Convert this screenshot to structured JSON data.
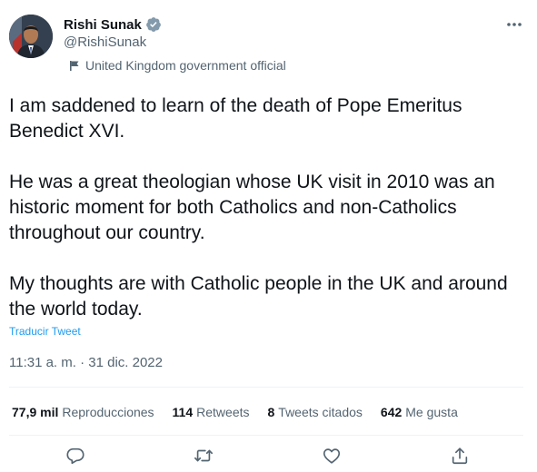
{
  "user": {
    "name": "Rishi Sunak",
    "handle": "@RishiSunak",
    "label": "United Kingdom government official"
  },
  "tweet": {
    "paragraphs": [
      "I am saddened to learn of the death of Pope Emeritus Benedict XVI.",
      "He was a great theologian whose UK visit in 2010 was an historic moment for both Catholics and non-Catholics throughout our country.",
      "My thoughts are with Catholic people in the UK and around the world today."
    ],
    "translate_label": "Traducir Tweet",
    "timestamp": "11:31 a. m. · 31 dic. 2022"
  },
  "stats": {
    "views": {
      "count": "77,9 mil",
      "label": "Reproducciones"
    },
    "retweets": {
      "count": "114",
      "label": "Retweets"
    },
    "quotes": {
      "count": "8",
      "label": "Tweets citados"
    },
    "likes": {
      "count": "642",
      "label": "Me gusta"
    }
  },
  "icons": {
    "verified": "verified-badge-icon",
    "more": "more-horizontal-icon",
    "label": "flag-icon",
    "reply": "reply-icon",
    "retweet": "retweet-icon",
    "like": "heart-icon",
    "share": "share-icon"
  },
  "colors": {
    "accent": "#1d9bf0",
    "secondary_text": "#536471",
    "primary_text": "#0f1419"
  }
}
